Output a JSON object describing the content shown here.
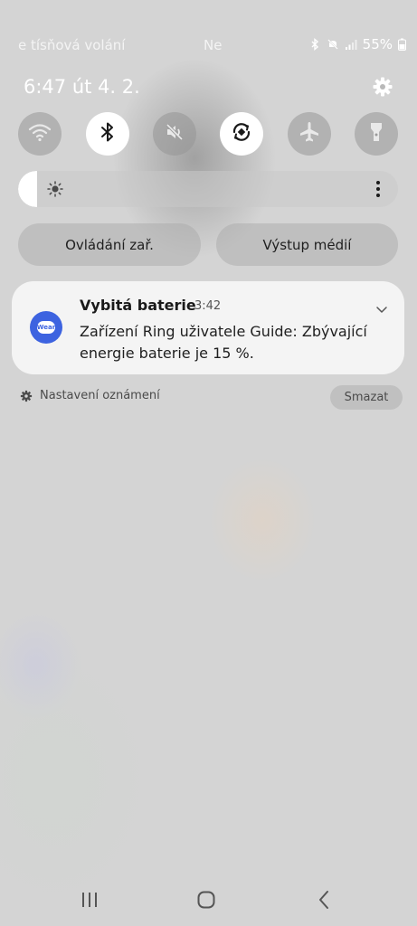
{
  "status_bar": {
    "left_text": "e tísňová volání",
    "center_text": "Ne",
    "battery_percent": "55%",
    "icons": [
      "bluetooth-icon",
      "mute-icon",
      "signal-icon",
      "battery-icon"
    ]
  },
  "header": {
    "time_date": "6:47  út 4. 2.",
    "settings_icon": "gear-icon"
  },
  "quick_toggles": [
    {
      "name": "wifi",
      "icon": "wifi-icon",
      "on": false
    },
    {
      "name": "bluetooth",
      "icon": "bluetooth-icon",
      "on": true
    },
    {
      "name": "sound",
      "icon": "mute-icon",
      "on": false
    },
    {
      "name": "auto-rotate",
      "icon": "rotate-icon",
      "on": true
    },
    {
      "name": "airplane",
      "icon": "airplane-icon",
      "on": false
    },
    {
      "name": "flashlight",
      "icon": "flashlight-icon",
      "on": false
    }
  ],
  "brightness": {
    "level": 0.05,
    "icon": "sun-icon",
    "more_icon": "more-vertical-icon"
  },
  "buttons": {
    "device_control": "Ovládání zař.",
    "media_output": "Výstup médií"
  },
  "notification": {
    "app_icon": "wear-app-icon",
    "app_icon_text": "Wear",
    "title": "Vybitá baterie",
    "time": "3:42",
    "body": "Zařízení Ring uživatele Guide: Zbývající energie baterie je 15 %.",
    "expand_icon": "chevron-down-icon"
  },
  "footer": {
    "notification_settings": "Nastavení oznámení",
    "clear": "Smazat"
  },
  "nav_bar": {
    "recents_icon": "recents-icon",
    "home_icon": "home-icon",
    "back_icon": "back-icon"
  },
  "colors": {
    "accent": "#3d63e0",
    "background": "#d4d4d4",
    "card": "#f4f4f4"
  }
}
